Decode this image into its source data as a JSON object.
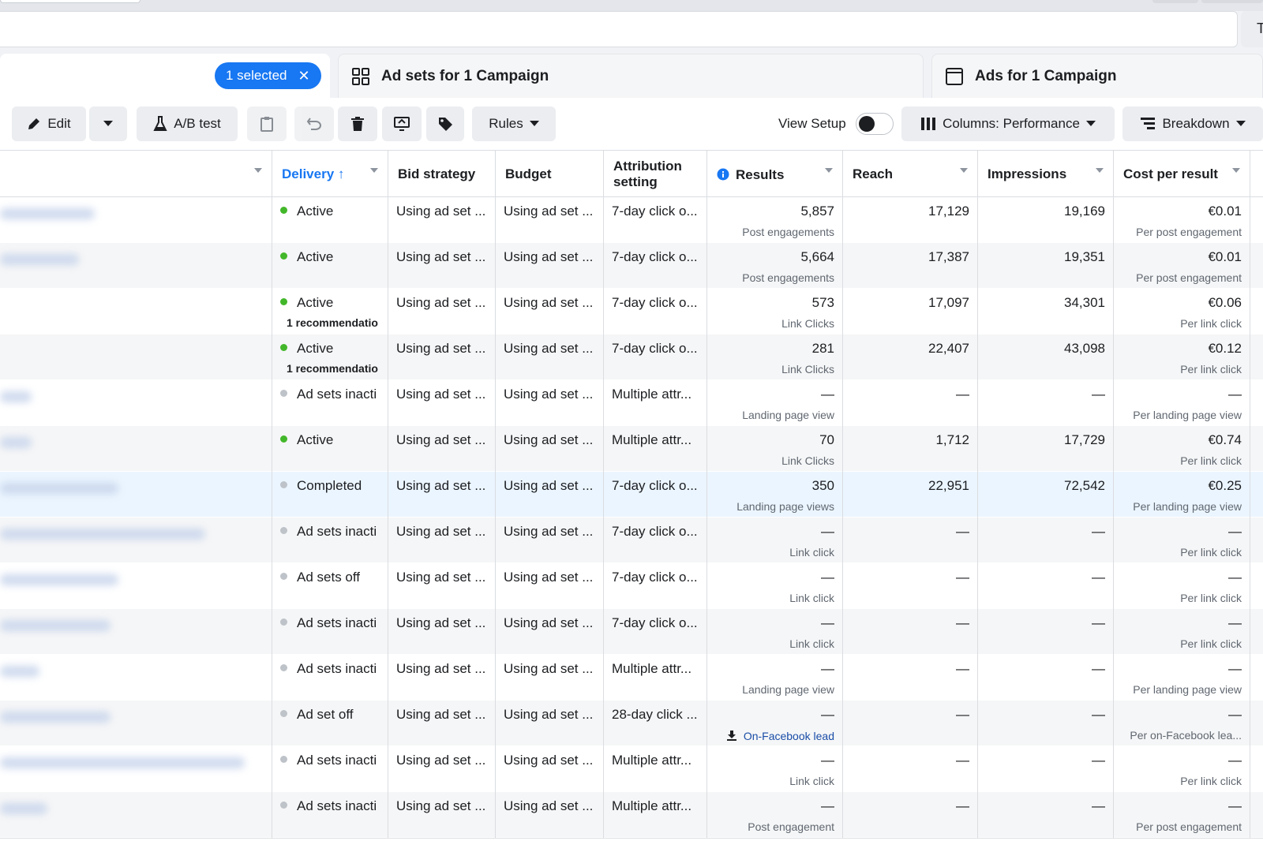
{
  "header": {
    "side_button_letter": "T"
  },
  "tabs": {
    "selected_label": "1 selected",
    "adsets_label": "Ad sets for 1 Campaign",
    "ads_label": "Ads for 1 Campaign"
  },
  "toolbar": {
    "edit_label": "Edit",
    "ab_test_label": "A/B test",
    "rules_label": "Rules",
    "view_setup_label": "View Setup",
    "columns_label": "Columns: Performance",
    "breakdown_label": "Breakdown"
  },
  "table": {
    "headers": {
      "delivery": "Delivery ↑",
      "bid_strategy": "Bid strategy",
      "budget": "Budget",
      "attribution_line1": "Attribution",
      "attribution_line2": "setting",
      "results": "Results",
      "reach": "Reach",
      "impressions": "Impressions",
      "cost_per_result": "Cost per result"
    },
    "rows": [
      {
        "delivery": "Active",
        "status": "green",
        "rec": "",
        "bid": "Using ad set ...",
        "budget": "Using ad set ...",
        "attr": "7-day click o...",
        "result": "5,857",
        "result_type": "Post engagements",
        "reach": "17,129",
        "impressions": "19,169",
        "cost": "€0.01",
        "cost_type": "Per post engagement"
      },
      {
        "delivery": "Active",
        "status": "green",
        "rec": "",
        "bid": "Using ad set ...",
        "budget": "Using ad set ...",
        "attr": "7-day click o...",
        "result": "5,664",
        "result_type": "Post engagements",
        "reach": "17,387",
        "impressions": "19,351",
        "cost": "€0.01",
        "cost_type": "Per post engagement"
      },
      {
        "delivery": "Active",
        "status": "green",
        "rec": "1 recommendatio",
        "bid": "Using ad set ...",
        "budget": "Using ad set ...",
        "attr": "7-day click o...",
        "result": "573",
        "result_type": "Link Clicks",
        "reach": "17,097",
        "impressions": "34,301",
        "cost": "€0.06",
        "cost_type": "Per link click"
      },
      {
        "delivery": "Active",
        "status": "green",
        "rec": "1 recommendatio",
        "bid": "Using ad set ...",
        "budget": "Using ad set ...",
        "attr": "7-day click o...",
        "result": "281",
        "result_type": "Link Clicks",
        "reach": "22,407",
        "impressions": "43,098",
        "cost": "€0.12",
        "cost_type": "Per link click"
      },
      {
        "delivery": "Ad sets inacti",
        "status": "gray",
        "rec": "",
        "bid": "Using ad set ...",
        "budget": "Using ad set ...",
        "attr": "Multiple attr...",
        "result": "—",
        "result_type": "Landing page view",
        "reach": "—",
        "impressions": "—",
        "cost": "—",
        "cost_type": "Per landing page view"
      },
      {
        "delivery": "Active",
        "status": "green",
        "rec": "",
        "bid": "Using ad set ...",
        "budget": "Using ad set ...",
        "attr": "Multiple attr...",
        "result": "70",
        "result_type": "Link Clicks",
        "reach": "1,712",
        "impressions": "17,729",
        "cost": "€0.74",
        "cost_type": "Per link click"
      },
      {
        "delivery": "Completed",
        "status": "gray",
        "rec": "",
        "bid": "Using ad set ...",
        "budget": "Using ad set ...",
        "attr": "7-day click o...",
        "result": "350",
        "result_type": "Landing page views",
        "reach": "22,951",
        "impressions": "72,542",
        "cost": "€0.25",
        "cost_type": "Per landing page view"
      },
      {
        "delivery": "Ad sets inacti",
        "status": "gray",
        "rec": "",
        "bid": "Using ad set ...",
        "budget": "Using ad set ...",
        "attr": "7-day click o...",
        "result": "—",
        "result_type": "Link click",
        "reach": "—",
        "impressions": "—",
        "cost": "—",
        "cost_type": "Per link click"
      },
      {
        "delivery": "Ad sets off",
        "status": "gray",
        "rec": "",
        "bid": "Using ad set ...",
        "budget": "Using ad set ...",
        "attr": "7-day click o...",
        "result": "—",
        "result_type": "Link click",
        "reach": "—",
        "impressions": "—",
        "cost": "—",
        "cost_type": "Per link click"
      },
      {
        "delivery": "Ad sets inacti",
        "status": "gray",
        "rec": "",
        "bid": "Using ad set ...",
        "budget": "Using ad set ...",
        "attr": "7-day click o...",
        "result": "—",
        "result_type": "Link click",
        "reach": "—",
        "impressions": "—",
        "cost": "—",
        "cost_type": "Per link click"
      },
      {
        "delivery": "Ad sets inacti",
        "status": "gray",
        "rec": "",
        "bid": "Using ad set ...",
        "budget": "Using ad set ...",
        "attr": "Multiple attr...",
        "result": "—",
        "result_type": "Landing page view",
        "reach": "—",
        "impressions": "—",
        "cost": "—",
        "cost_type": "Per landing page view"
      },
      {
        "delivery": "Ad set off",
        "status": "gray",
        "rec": "",
        "bid": "Using ad set ...",
        "budget": "Using ad set ...",
        "attr": "28-day click ...",
        "result": "—",
        "result_type": "On-Facebook lead",
        "reach": "—",
        "impressions": "—",
        "cost": "—",
        "cost_type": "Per on-Facebook lea..."
      },
      {
        "delivery": "Ad sets inacti",
        "status": "gray",
        "rec": "",
        "bid": "Using ad set ...",
        "budget": "Using ad set ...",
        "attr": "Multiple attr...",
        "result": "—",
        "result_type": "Link click",
        "reach": "—",
        "impressions": "—",
        "cost": "—",
        "cost_type": "Per link click"
      },
      {
        "delivery": "Ad sets inacti",
        "status": "gray",
        "rec": "",
        "bid": "Using ad set ...",
        "budget": "Using ad set ...",
        "attr": "Multiple attr...",
        "result": "—",
        "result_type": "Post engagement",
        "reach": "—",
        "impressions": "—",
        "cost": "—",
        "cost_type": "Per post engagement"
      }
    ]
  },
  "colors": {
    "accent": "#1877f2",
    "status_green": "#42b72a",
    "status_gray": "#bec3c9",
    "link_blue": "#1a4ea8"
  }
}
